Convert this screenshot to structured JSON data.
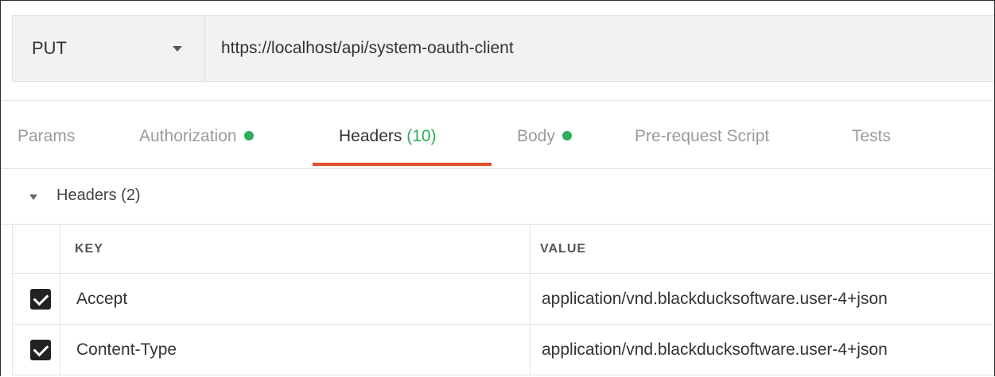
{
  "request": {
    "method": "PUT",
    "url": "https://localhost/api/system-oauth-client"
  },
  "tabs": [
    {
      "label": "Params",
      "active": false,
      "indicator": false
    },
    {
      "label": "Authorization",
      "active": false,
      "indicator": true
    },
    {
      "label": "Headers",
      "count": "(10)",
      "active": true,
      "indicator": false
    },
    {
      "label": "Body",
      "active": false,
      "indicator": true
    },
    {
      "label": "Pre-request Script",
      "active": false,
      "indicator": false
    },
    {
      "label": "Tests",
      "active": false,
      "indicator": false
    }
  ],
  "headers_section": {
    "title": "Headers (2)",
    "columns": {
      "key": "KEY",
      "value": "VALUE"
    },
    "rows": [
      {
        "checked": true,
        "key": "Accept",
        "value": "application/vnd.blackducksoftware.user-4+json"
      },
      {
        "checked": true,
        "key": "Content-Type",
        "value": "application/vnd.blackducksoftware.user-4+json"
      }
    ]
  },
  "colors": {
    "accent": "#e2502e",
    "status_dot": "#2eab5f",
    "count": "#2eab5f"
  }
}
